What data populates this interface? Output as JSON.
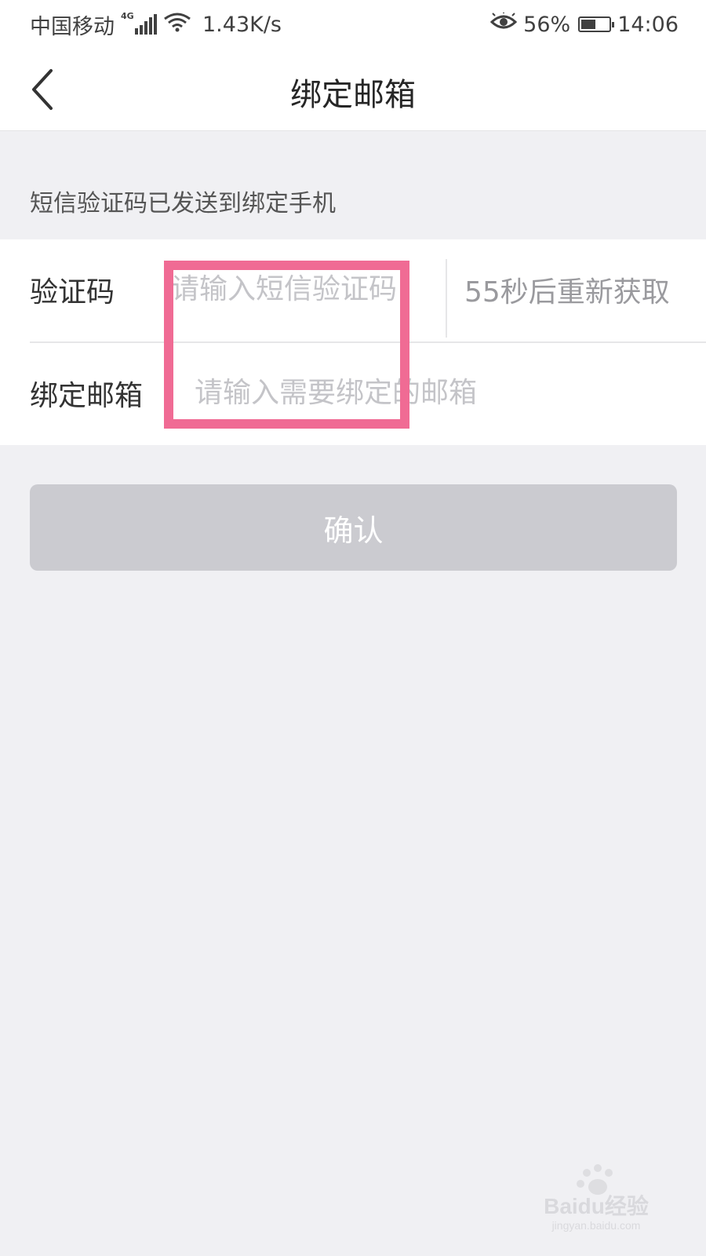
{
  "status_bar": {
    "carrier": "中国移动",
    "network_type": "4G",
    "speed": "1.43K/s",
    "battery": "56%",
    "battery_level": 0.56,
    "time": "14:06",
    "icons": [
      "signal-icon",
      "wifi-icon",
      "eye-icon",
      "battery-icon"
    ]
  },
  "nav": {
    "back_icon": "chevron-left-icon",
    "title": "绑定邮箱"
  },
  "hint": "短信验证码已发送到绑定手机",
  "form": {
    "code": {
      "label": "验证码",
      "value": "",
      "placeholder": "请输入短信验证码",
      "resend": "55秒后重新获取"
    },
    "email": {
      "label": "绑定邮箱",
      "value": "",
      "placeholder": "请输入需要绑定的邮箱"
    }
  },
  "confirm_label": "确认",
  "colors": {
    "highlight": "#f06b94",
    "button_bg": "#cbcbd0",
    "page_bg": "#f0f0f3"
  },
  "watermark": {
    "brand": "Baidu经验",
    "url": "jingyan.baidu.com"
  }
}
